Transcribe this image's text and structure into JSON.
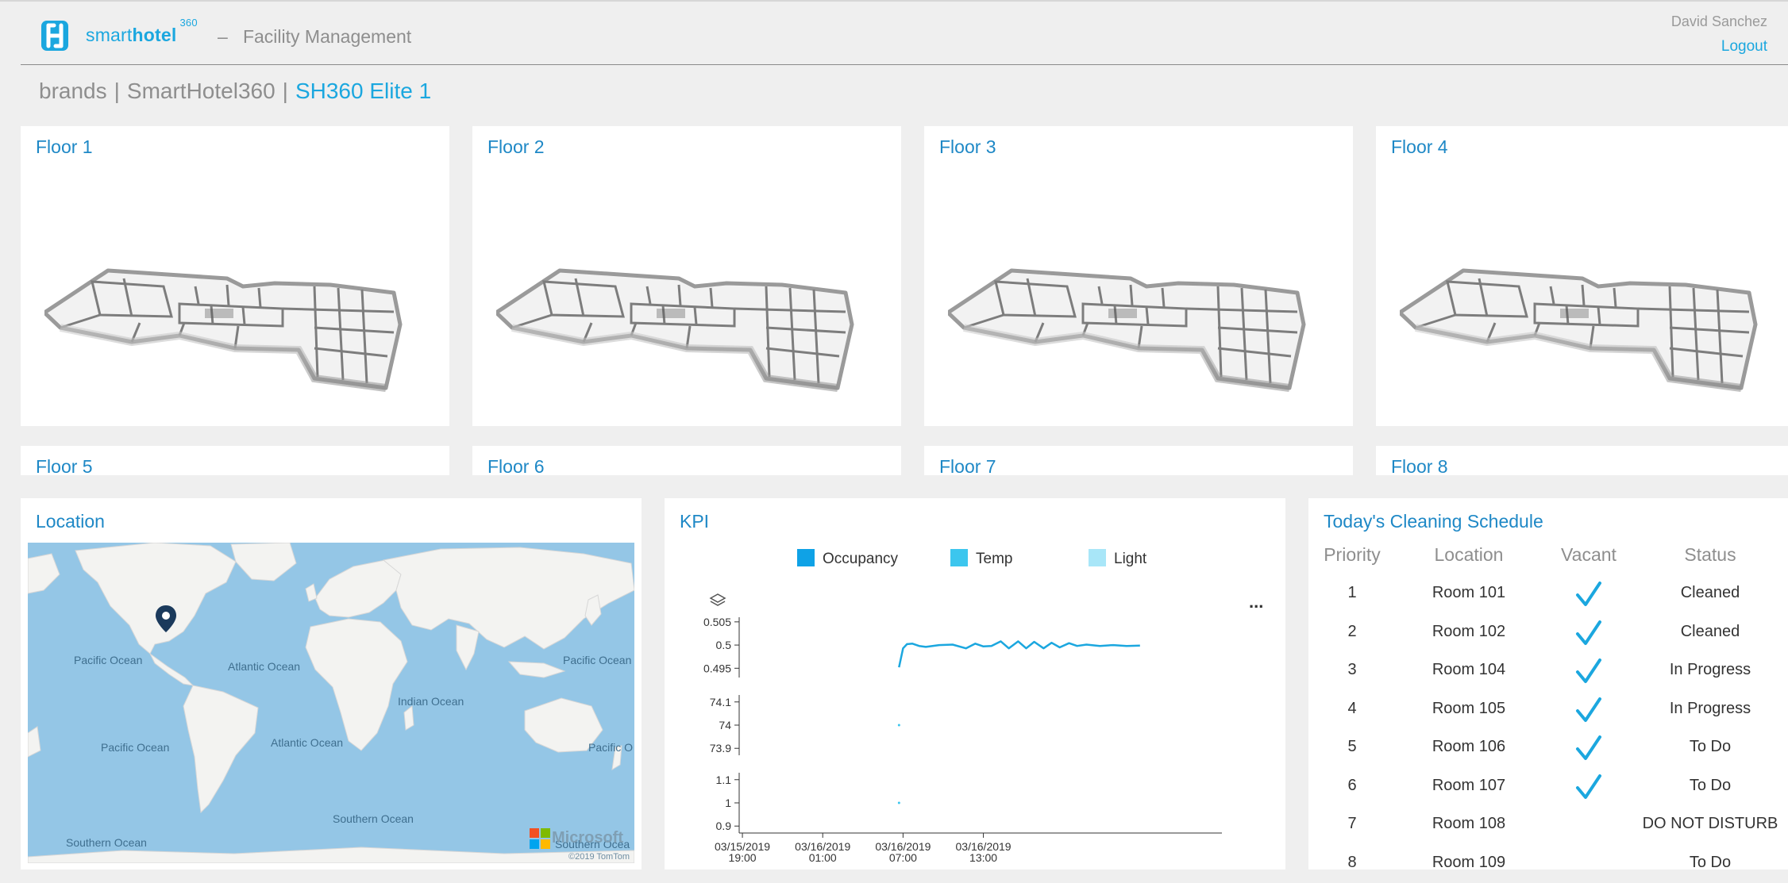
{
  "app": {
    "brand_light": "smart",
    "brand_bold": "hotel",
    "brand_sup": "360",
    "separator": "–",
    "title": "Facility Management",
    "user_name": "David Sanchez",
    "logout_label": "Logout",
    "accent_color": "#1ba7df"
  },
  "breadcrumb": {
    "items": [
      "brands",
      "SmartHotel360",
      "SH360 Elite 1"
    ],
    "separator": "|"
  },
  "floors": [
    {
      "label": "Floor 1"
    },
    {
      "label": "Floor 2"
    },
    {
      "label": "Floor 3"
    },
    {
      "label": "Floor 4"
    },
    {
      "label": "Floor 5"
    },
    {
      "label": "Floor 6"
    },
    {
      "label": "Floor 7"
    },
    {
      "label": "Floor 8"
    }
  ],
  "location": {
    "title": "Location",
    "labels": {
      "pacific_1": "Pacific Ocean",
      "atlantic_1": "Atlantic Ocean",
      "indian": "Indian Ocean",
      "pacific_2": "Pacific Ocean",
      "pacific_3": "Pacific Ocean",
      "atlantic_2": "Atlantic Ocean",
      "pacific_4": "Pacific O",
      "southern_1": "Southern Ocean",
      "southern_2": "Southern Ocean",
      "southern_3": "Southern Ocea",
      "microsoft": "Microsoft",
      "copyright": "©2019 TomTom"
    },
    "pin_icon": "map-pin-icon"
  },
  "kpi": {
    "title": "KPI",
    "more_label": "...",
    "layers_icon": "layers-icon",
    "legend": [
      {
        "name": "Occupancy",
        "color": "#0fa2e6"
      },
      {
        "name": "Temp",
        "color": "#3cc6ee"
      },
      {
        "name": "Light",
        "color": "#a8e6f8"
      }
    ]
  },
  "chart_data": {
    "type": "line",
    "x_ticks": [
      {
        "date": "03/15/2019",
        "time": "19:00"
      },
      {
        "date": "03/16/2019",
        "time": "01:00"
      },
      {
        "date": "03/16/2019",
        "time": "07:00"
      },
      {
        "date": "03/16/2019",
        "time": "13:00"
      }
    ],
    "panels": [
      {
        "series": "Occupancy",
        "y_ticks": [
          "0.505",
          "0.5",
          "0.495"
        ],
        "ylim": [
          0.493,
          0.506
        ]
      },
      {
        "series": "Temp",
        "y_ticks": [
          "74.1",
          "74",
          "73.9"
        ],
        "ylim": [
          73.87,
          74.13
        ]
      },
      {
        "series": "Light",
        "y_ticks": [
          "1.1",
          "1",
          "0.9"
        ],
        "ylim": [
          0.87,
          1.13
        ]
      }
    ],
    "series": [
      {
        "name": "Occupancy",
        "x_hours": [
          12.0,
          12.3,
          12.6,
          13.0,
          13.5,
          14.0,
          15.0,
          16.0,
          17.0,
          17.7,
          18.3,
          18.9,
          19.6,
          20.2,
          20.9,
          21.5,
          22.1,
          22.8,
          23.4,
          24.0,
          24.7,
          25.3,
          26.0,
          27.0,
          28.0,
          29.0,
          30.0
        ],
        "values": [
          0.4952,
          0.4993,
          0.5002,
          0.5003,
          0.4998,
          0.4996,
          0.5,
          0.5001,
          0.4993,
          0.5003,
          0.4997,
          0.4998,
          0.5008,
          0.4993,
          0.5008,
          0.4993,
          0.5007,
          0.4993,
          0.5005,
          0.4995,
          0.5004,
          0.4998,
          0.5001,
          0.4998,
          0.5,
          0.4998,
          0.4999
        ]
      },
      {
        "name": "Temp",
        "x_hours": [
          12.0
        ],
        "values": [
          74.0
        ]
      },
      {
        "name": "Light",
        "x_hours": [
          12.0
        ],
        "values": [
          1.0
        ]
      }
    ]
  },
  "cleaning": {
    "title": "Today's Cleaning Schedule",
    "headers": [
      "Priority",
      "Location",
      "Vacant",
      "Status"
    ],
    "rows": [
      {
        "priority": "1",
        "location": "Room 101",
        "vacant": true,
        "status": "Cleaned"
      },
      {
        "priority": "2",
        "location": "Room 102",
        "vacant": true,
        "status": "Cleaned"
      },
      {
        "priority": "3",
        "location": "Room 104",
        "vacant": true,
        "status": "In Progress"
      },
      {
        "priority": "4",
        "location": "Room 105",
        "vacant": true,
        "status": "In Progress"
      },
      {
        "priority": "5",
        "location": "Room 106",
        "vacant": true,
        "status": "To Do"
      },
      {
        "priority": "6",
        "location": "Room 107",
        "vacant": true,
        "status": "To Do"
      },
      {
        "priority": "7",
        "location": "Room 108",
        "vacant": false,
        "status": "DO NOT DISTURB"
      },
      {
        "priority": "8",
        "location": "Room 109",
        "vacant": false,
        "status": "To Do"
      }
    ],
    "check_icon": "checkmark-icon"
  }
}
